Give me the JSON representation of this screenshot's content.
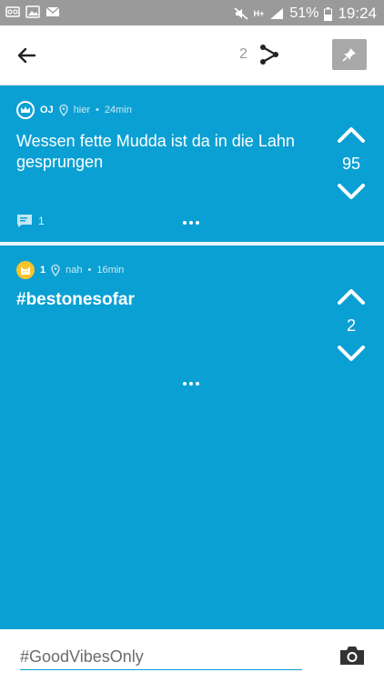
{
  "status_bar": {
    "battery_percent": "51%",
    "time": "19:24",
    "network_label": "H+"
  },
  "topbar": {
    "share_count": "2",
    "colors": {
      "background": "#ffffff",
      "pin_button": "#a8a8a8"
    }
  },
  "posts": [
    {
      "username": "OJ",
      "location": "hier",
      "separator": "•",
      "age": "24min",
      "text": "Wessen fette Mudda ist da in die Lahn gesprungen",
      "votes": "95",
      "comment_count": "1",
      "avatar_icon": "crown-icon"
    },
    {
      "username": "1",
      "location": "nah",
      "separator": "•",
      "age": "16min",
      "text": "#bestonesofar",
      "votes": "2",
      "avatar_icon": "cat-icon"
    }
  ],
  "compose": {
    "placeholder": "#GoodVibesOnly"
  },
  "colors": {
    "post_background": "#0ba0d3",
    "avatar_yellow": "#f7c32e",
    "status_bar": "#9a9a9a"
  }
}
